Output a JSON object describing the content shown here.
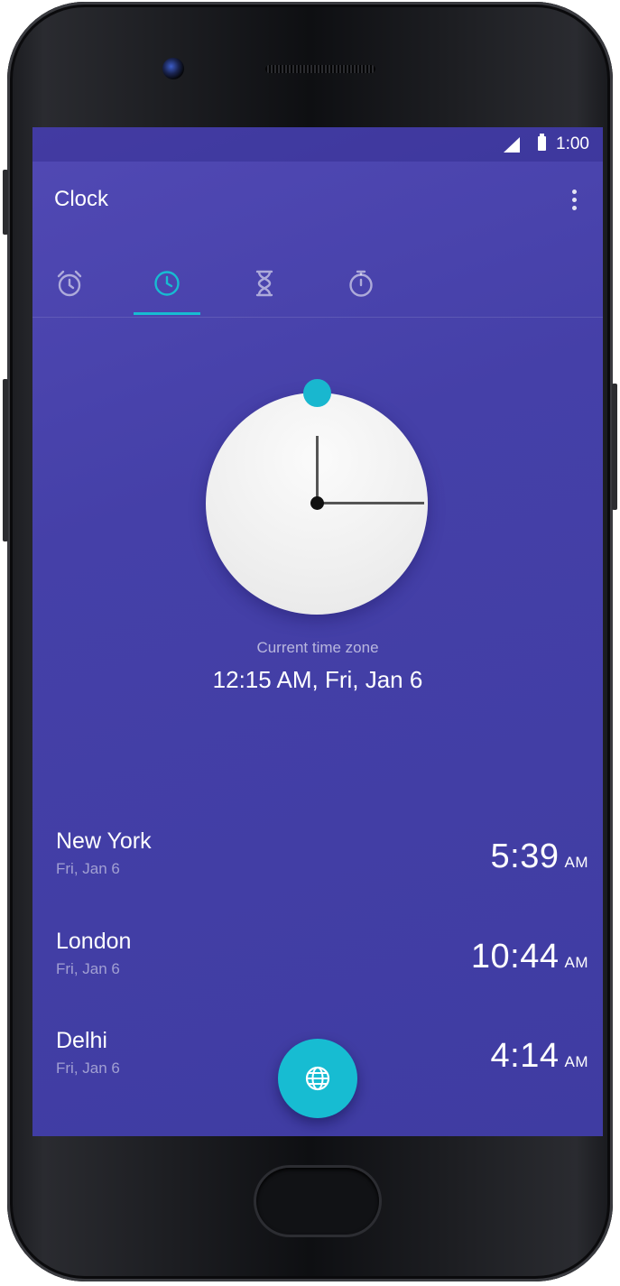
{
  "statusbar": {
    "time": "1:00",
    "icons": [
      "signal-icon",
      "battery-icon"
    ]
  },
  "appbar": {
    "title": "Clock",
    "menu_icon": "overflow-menu-icon"
  },
  "tabs": [
    {
      "icon": "alarm-icon",
      "selected": false
    },
    {
      "icon": "clock-icon",
      "selected": true
    },
    {
      "icon": "hourglass-icon",
      "selected": false
    },
    {
      "icon": "stopwatch-icon",
      "selected": false
    }
  ],
  "current": {
    "label": "Current time zone",
    "time": "12:15 AM, Fri, Jan 6"
  },
  "cities": [
    {
      "name": "New York",
      "date": "Fri, Jan 6",
      "time": "5:39",
      "ampm": "AM"
    },
    {
      "name": "London",
      "date": "Fri, Jan 6",
      "time": "10:44",
      "ampm": "AM"
    },
    {
      "name": "Delhi",
      "date": "Fri, Jan 6",
      "time": "4:14",
      "ampm": "AM"
    }
  ],
  "fab": {
    "icon": "globe-icon"
  },
  "colors": {
    "background": "#4540a8",
    "accent": "#17bcd2",
    "dial": "#f2f2f2"
  }
}
